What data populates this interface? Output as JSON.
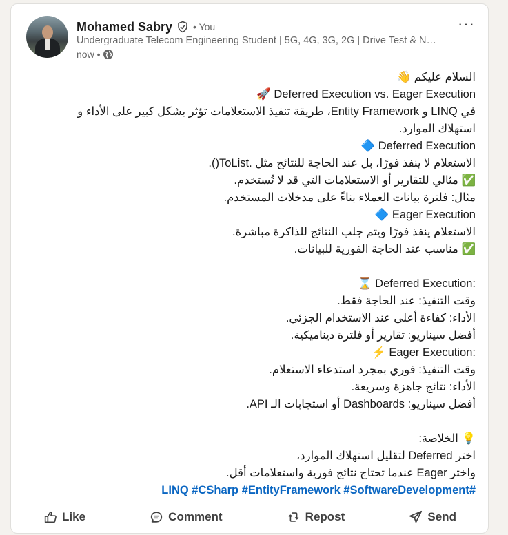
{
  "author": {
    "name": "Mohamed Sabry",
    "relation": "• You",
    "headline": "Undergraduate Telecom Engineering Student | 5G, 4G, 3G, 2G | Drive Test & N…",
    "time": "now •"
  },
  "post": {
    "lines": [
      "السلام عليكم 👋",
      "🚀 Deferred Execution vs. Eager Execution",
      "في LINQ و Entity Framework، طريقة تنفيذ الاستعلامات تؤثر بشكل كبير على الأداء و",
      "استهلاك الموارد.",
      "🔷 Deferred Execution",
      "الاستعلام لا ينفذ فورًا، بل عند الحاجة للنتائج مثل .ToList().",
      "✅ مثالي للتقارير أو الاستعلامات التي قد لا تُستخدم.",
      "مثال: فلترة بيانات العملاء بناءً على مدخلات المستخدم.",
      "🔷 Eager Execution",
      "الاستعلام ينفذ فورًا ويتم جلب النتائج للذاكرة مباشرة.",
      "✅ مناسب عند الحاجة الفورية للبيانات.",
      "",
      "⌛ Deferred Execution:",
      "وقت التنفيذ: عند الحاجة فقط.",
      "الأداء: كفاءة أعلى عند الاستخدام الجزئي.",
      "أفضل سيناريو: تقارير أو فلترة ديناميكية.",
      "⚡ Eager Execution:",
      "وقت التنفيذ: فوري بمجرد استدعاء الاستعلام.",
      "الأداء: نتائج جاهزة وسريعة.",
      "أفضل سيناريو: Dashboards أو استجابات الـ API.",
      "",
      "💡 الخلاصة:",
      "اختر Deferred لتقليل استهلاك الموارد،",
      "واختر Eager عندما تحتاج نتائج فورية واستعلامات أقل."
    ],
    "hashtags": "LINQ #CSharp #EntityFramework #SoftwareDevelopment#"
  },
  "actions": {
    "like": "Like",
    "comment": "Comment",
    "repost": "Repost",
    "send": "Send"
  },
  "icons": {
    "verified": "verified-shield-icon",
    "globe": "globe-icon",
    "more": "more-options-icon",
    "like": "thumbs-up-icon",
    "comment": "comment-bubble-icon",
    "repost": "repost-icon",
    "send": "send-icon"
  },
  "colors": {
    "hashtag": "#0a66c2",
    "text": "#191919",
    "secondary": "#666666"
  }
}
